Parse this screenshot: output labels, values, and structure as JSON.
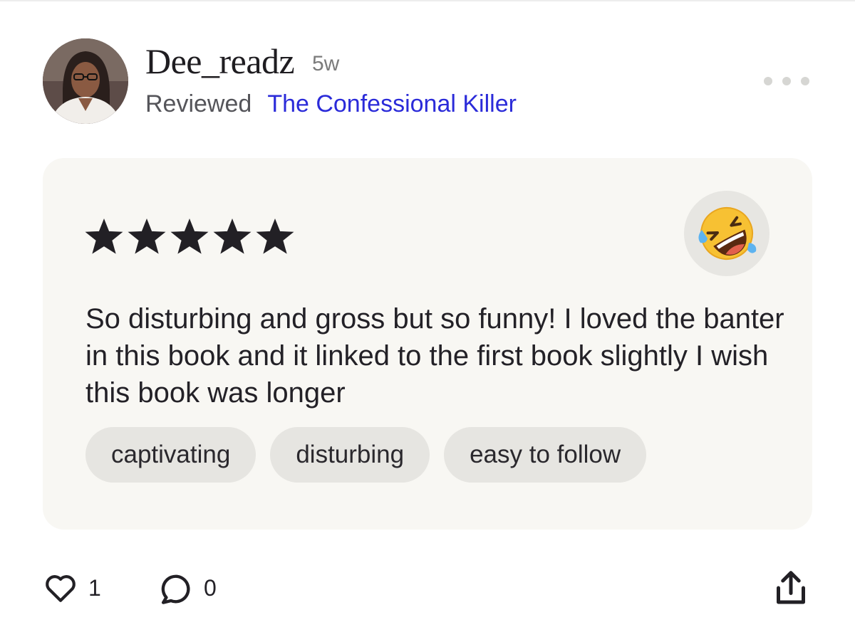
{
  "post": {
    "username": "Dee_readz",
    "time_ago": "5w",
    "action_label": "Reviewed",
    "book_title": "The Confessional Killer"
  },
  "review": {
    "rating": 5,
    "rating_max": 5,
    "emoji": "rolling-on-the-floor-laughing",
    "text": "So disturbing and gross but so funny! I loved the banter in this book and it linked to the first book slightly I wish this book was longer",
    "tags": [
      "captivating",
      "disturbing",
      "easy to follow"
    ]
  },
  "actions": {
    "like_count": "1",
    "comment_count": "0"
  },
  "icons": [
    "more-icon",
    "star-icon",
    "heart-icon",
    "comment-icon",
    "share-icon"
  ],
  "colors": {
    "link": "#2b2bd9",
    "card_background": "#f8f7f3",
    "tag_background": "#e6e5e1",
    "star": "#222025"
  }
}
